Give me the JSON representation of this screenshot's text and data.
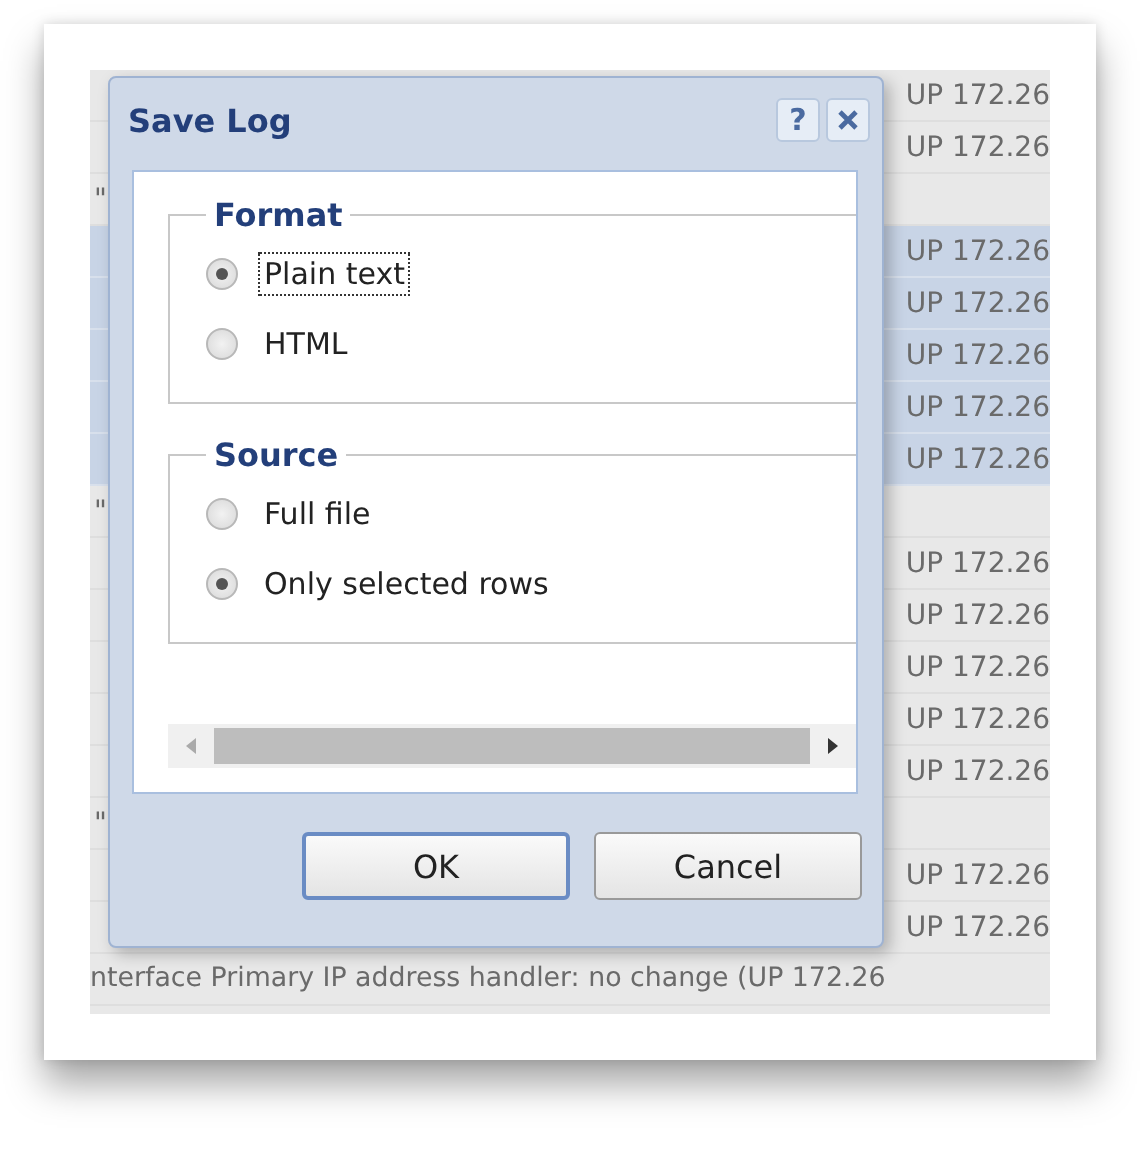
{
  "log": {
    "rows": [
      {
        "kind": "covered",
        "text": "UP 172.26",
        "selected": false
      },
      {
        "kind": "covered",
        "text": "UP 172.26",
        "selected": false
      },
      {
        "kind": "mark",
        "text": "\"",
        "selected": false
      },
      {
        "kind": "covered",
        "text": "UP 172.26",
        "selected": true
      },
      {
        "kind": "covered",
        "text": "UP 172.26",
        "selected": true
      },
      {
        "kind": "covered",
        "text": "UP 172.26",
        "selected": true
      },
      {
        "kind": "covered",
        "text": "UP 172.26",
        "selected": true
      },
      {
        "kind": "covered",
        "text": "UP 172.26",
        "selected": true
      },
      {
        "kind": "mark",
        "text": "\"",
        "selected": false
      },
      {
        "kind": "covered",
        "text": "UP 172.26",
        "selected": false
      },
      {
        "kind": "covered",
        "text": "UP 172.26",
        "selected": false
      },
      {
        "kind": "covered",
        "text": "UP 172.26",
        "selected": false
      },
      {
        "kind": "covered",
        "text": "UP 172.26",
        "selected": false
      },
      {
        "kind": "covered",
        "text": "UP 172.26",
        "selected": false
      },
      {
        "kind": "mark",
        "text": "\"",
        "selected": false
      },
      {
        "kind": "covered",
        "text": "UP 172.26",
        "selected": false
      },
      {
        "kind": "covered",
        "text": "UP 172.26",
        "selected": false
      },
      {
        "kind": "full",
        "text": "nterface Primary IP address handler: no change (UP 172.26",
        "selected": false
      }
    ]
  },
  "dialog": {
    "title": "Save Log",
    "help": "?",
    "groups": [
      {
        "legend": "Format",
        "options": [
          {
            "label": "Plain text",
            "selected": true,
            "focused": true
          },
          {
            "label": "HTML",
            "selected": false,
            "focused": false
          }
        ]
      },
      {
        "legend": "Source",
        "options": [
          {
            "label": "Full file",
            "selected": false,
            "focused": false
          },
          {
            "label": "Only selected rows",
            "selected": true,
            "focused": false
          }
        ]
      }
    ],
    "buttons": [
      {
        "label": "OK",
        "default": true
      },
      {
        "label": "Cancel",
        "default": false
      }
    ]
  }
}
